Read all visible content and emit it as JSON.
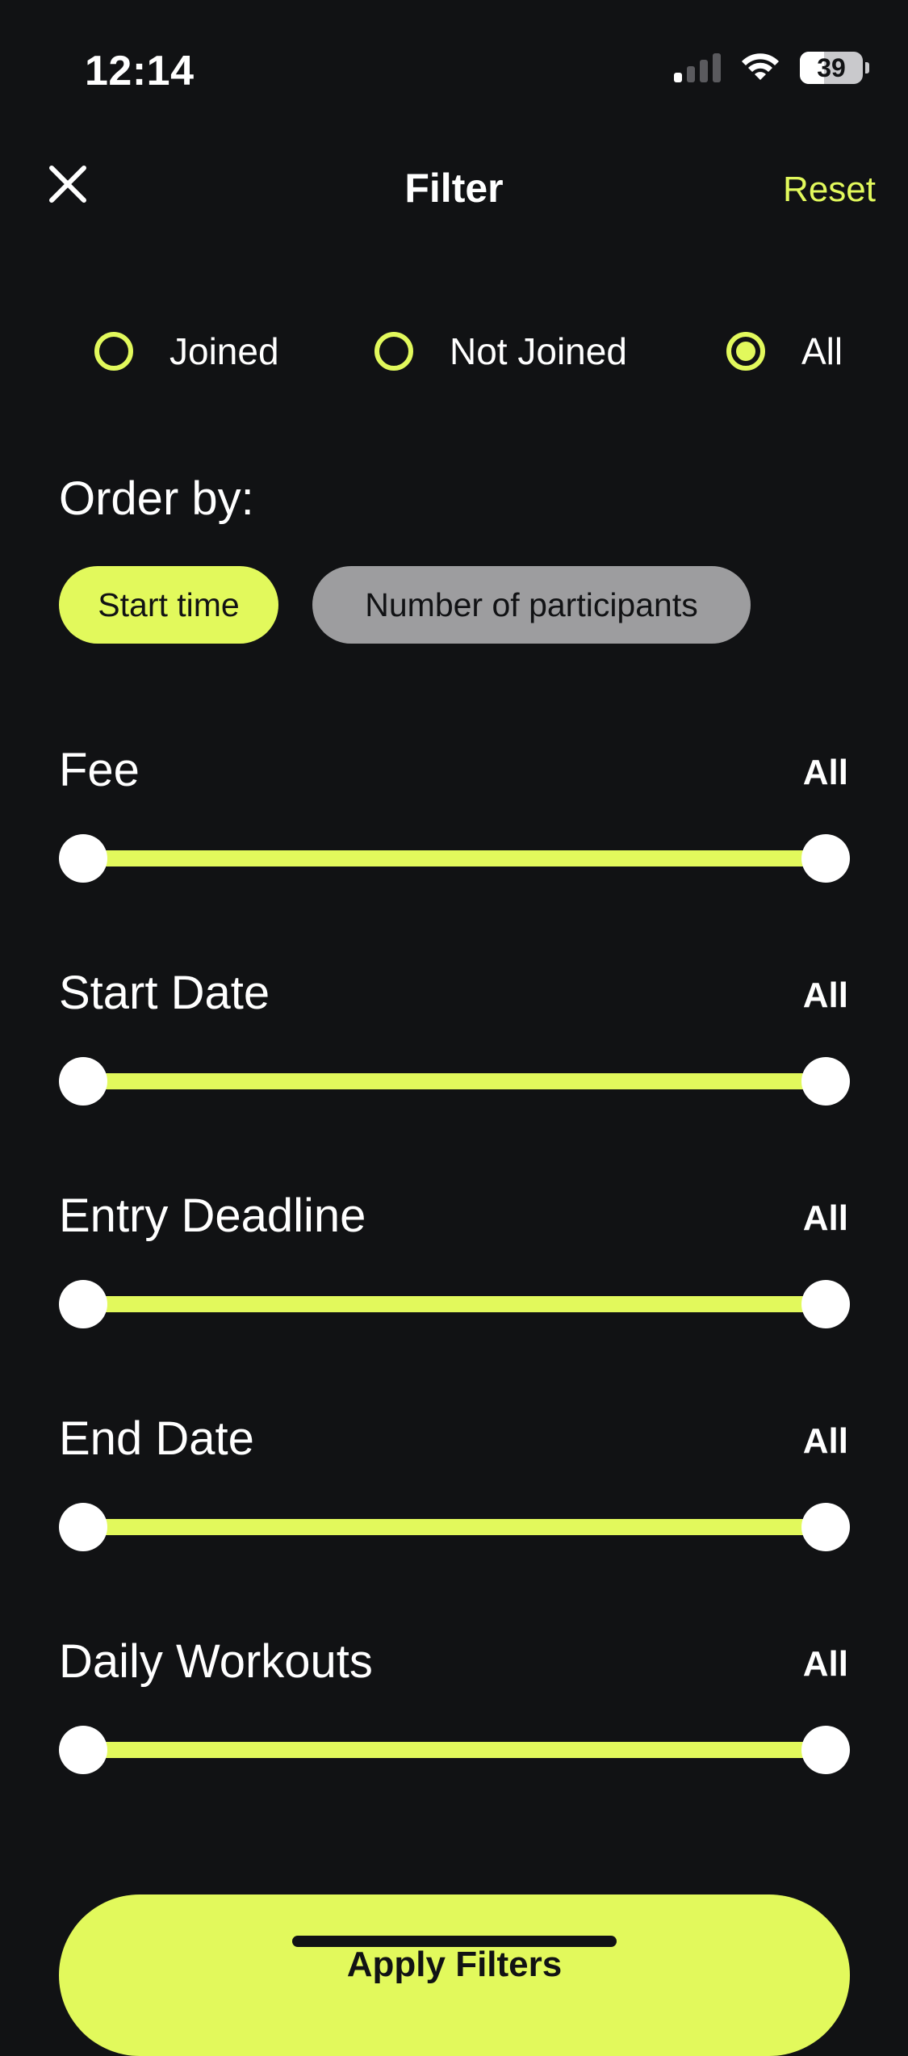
{
  "status_bar": {
    "time": "12:14",
    "battery_percent": "39"
  },
  "header": {
    "title": "Filter",
    "reset_label": "Reset"
  },
  "membership": {
    "options": [
      "Joined",
      "Not Joined",
      "All"
    ],
    "selected": "All"
  },
  "order_by": {
    "label": "Order by:",
    "options": [
      "Start time",
      "Number of participants"
    ],
    "selected": "Start time"
  },
  "filters": [
    {
      "label": "Fee",
      "value": "All"
    },
    {
      "label": "Start Date",
      "value": "All"
    },
    {
      "label": "Entry Deadline",
      "value": "All"
    },
    {
      "label": "End Date",
      "value": "All"
    },
    {
      "label": "Daily Workouts",
      "value": "All"
    }
  ],
  "apply_label": "Apply Filters",
  "colors": {
    "background": "#111214",
    "accent": "#e2f95c",
    "chip_inactive": "#9d9d9f",
    "text": "#ffffff"
  }
}
